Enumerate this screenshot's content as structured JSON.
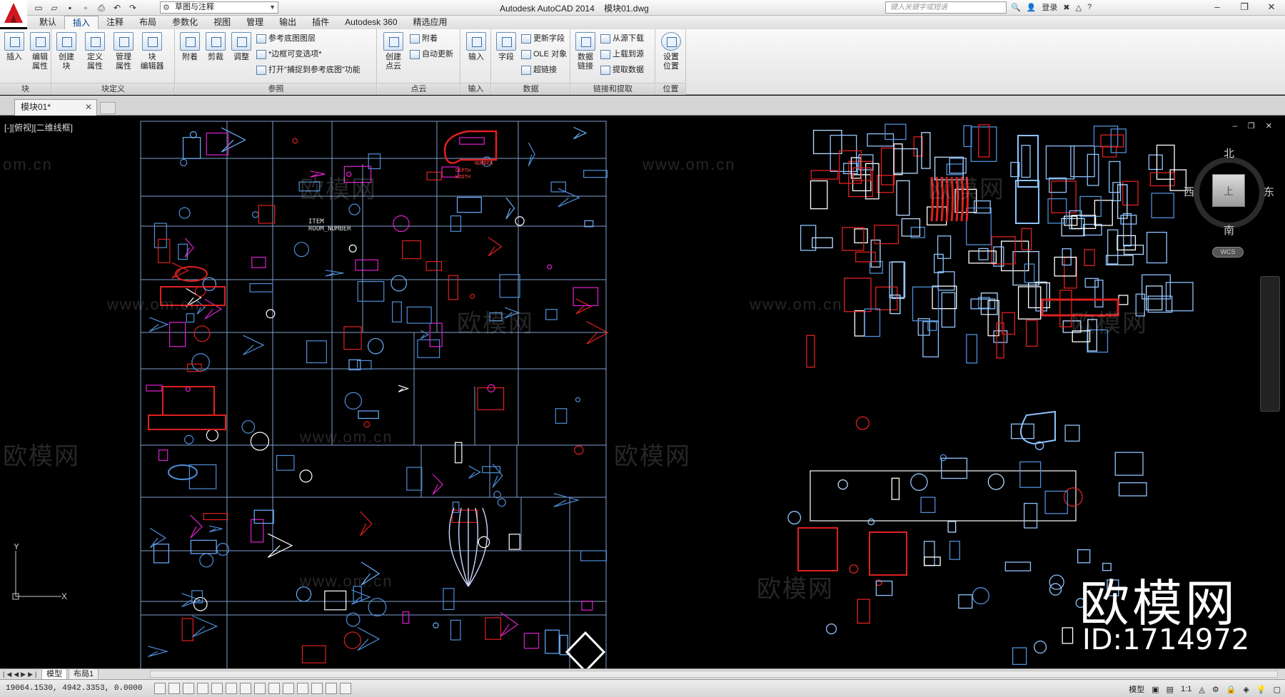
{
  "window": {
    "title": "Autodesk AutoCAD 2014    模块01.dwg",
    "workspace": "草图与注释",
    "search_placeholder": "键入关键字或短语",
    "login_label": "登录"
  },
  "ribbon_tabs": [
    "默认",
    "插入",
    "注释",
    "布局",
    "参数化",
    "视图",
    "管理",
    "输出",
    "插件",
    "Autodesk 360",
    "精选应用"
  ],
  "active_tab": "插入",
  "panels": {
    "block": {
      "title": "块",
      "buttons": [
        "插入",
        "编辑\n属性"
      ]
    },
    "block_def": {
      "title": "块定义",
      "buttons": [
        "创建\n块",
        "定义\n属性",
        "管理\n属性",
        "块\n编辑器"
      ]
    },
    "reference": {
      "title": "参照",
      "buttons": [
        "附着",
        "剪裁",
        "调整"
      ],
      "small": [
        "参考底图图层",
        "*边框可变选项*",
        "打开\"捕捉到参考底图\"功能"
      ]
    },
    "pointcloud": {
      "title": "点云",
      "buttons": [
        "创建\n点云"
      ],
      "small": [
        "附着",
        "自动更新"
      ]
    },
    "import": {
      "title": "输入",
      "buttons": [
        "输入"
      ]
    },
    "data": {
      "title": "数据",
      "buttons": [
        "字段"
      ],
      "small": [
        "更新字段",
        "OLE 对象",
        "超链接"
      ]
    },
    "linking": {
      "title": "链接和提取",
      "buttons": [
        "数据\n链接"
      ],
      "small": [
        "从源下载",
        "上载到源",
        "提取数据"
      ]
    },
    "location": {
      "title": "位置",
      "buttons": [
        "设置\n位置"
      ]
    }
  },
  "document_tab": "模块01*",
  "viewport_label": "[-][俯视][二维线框]",
  "viewcube": {
    "north": "北",
    "south": "南",
    "west": "西",
    "east": "东",
    "face": "上",
    "wcs": "WCS"
  },
  "drawing_text": {
    "item": "ITEM",
    "room_number": "ROOM_NUMBER",
    "depth": "DEPTH",
    "width": "WIDTH",
    "number": "NUMBER"
  },
  "watermarks": {
    "url": "www.om.cn",
    "brand": "欧模网",
    "url_left": "om.cn",
    "brand_left": "欧模网"
  },
  "brand_overlay": {
    "name": "欧模网",
    "id": "ID:1714972"
  },
  "layout_tabs": [
    "模型",
    "布局1"
  ],
  "status": {
    "coords": "19064.1530,  4942.3353,  0.0000",
    "model_label": "模型",
    "scale": "1:1"
  },
  "colors": {
    "cad_blue": "#4f8fd8",
    "cad_red": "#e02020",
    "cad_magenta": "#e020d0",
    "grid_line": "#7f9fcf"
  }
}
